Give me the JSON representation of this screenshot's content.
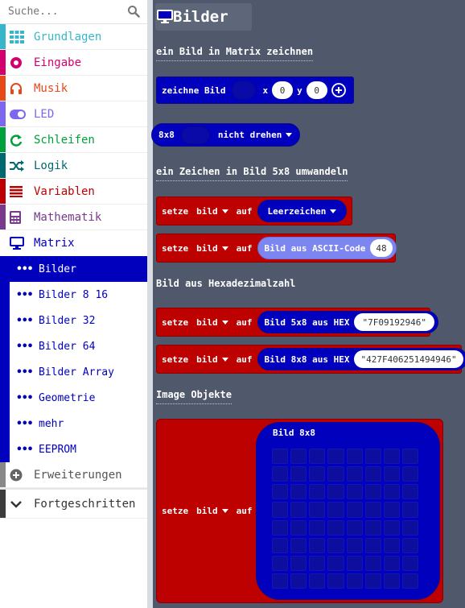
{
  "search": {
    "placeholder": "Suche..."
  },
  "categories": [
    {
      "label": "Grundlagen",
      "color": "#36b6c8",
      "icon": "grid-icon"
    },
    {
      "label": "Eingabe",
      "color": "#d4006d",
      "icon": "circle-dot-icon"
    },
    {
      "label": "Musik",
      "color": "#e64a19",
      "icon": "headphones-icon"
    },
    {
      "label": "LED",
      "color": "#7b68ee",
      "icon": "toggle-icon"
    },
    {
      "label": "Schleifen",
      "color": "#00a03c",
      "icon": "loop-icon"
    },
    {
      "label": "Logik",
      "color": "#006970",
      "icon": "shuffle-icon"
    },
    {
      "label": "Variablen",
      "color": "#bd0000",
      "icon": "list-icon"
    },
    {
      "label": "Mathematik",
      "color": "#7a3a8b",
      "icon": "calculator-icon"
    },
    {
      "label": "Matrix",
      "color": "#0000bd",
      "icon": "monitor-icon"
    }
  ],
  "subcategories": [
    "Bilder",
    "Bilder 8 16",
    "Bilder 32",
    "Bilder 64",
    "Bilder Array",
    "Geometrie",
    "mehr",
    "EEPROM"
  ],
  "extras": {
    "extensions": "Erweiterungen",
    "advanced": "Fortgeschritten"
  },
  "workspace": {
    "title": "Bilder",
    "sections": [
      "ein Bild in Matrix zeichnen",
      "ein Zeichen in Bild 5x8 umwandeln",
      "Bild aus Hexadezimalzahl",
      "Image Objekte"
    ],
    "block1": {
      "label": "zeichne Bild",
      "x": "x",
      "x_val": "0",
      "y": "y",
      "y_val": "0"
    },
    "block2": {
      "label": "8x8",
      "option": "nicht drehen"
    },
    "set_label": "setze",
    "var": "bild",
    "on": "auf",
    "block3": {
      "value": "Leerzeichen"
    },
    "block4": {
      "label": "Bild aus ASCII-Code",
      "value": "48"
    },
    "block5": {
      "label": "Bild 5x8 aus HEX",
      "value": "7F09192946"
    },
    "block6": {
      "label": "Bild 8x8 aus HEX",
      "value": "427F406251494946"
    },
    "block7": {
      "label": "Bild 8x8"
    }
  }
}
